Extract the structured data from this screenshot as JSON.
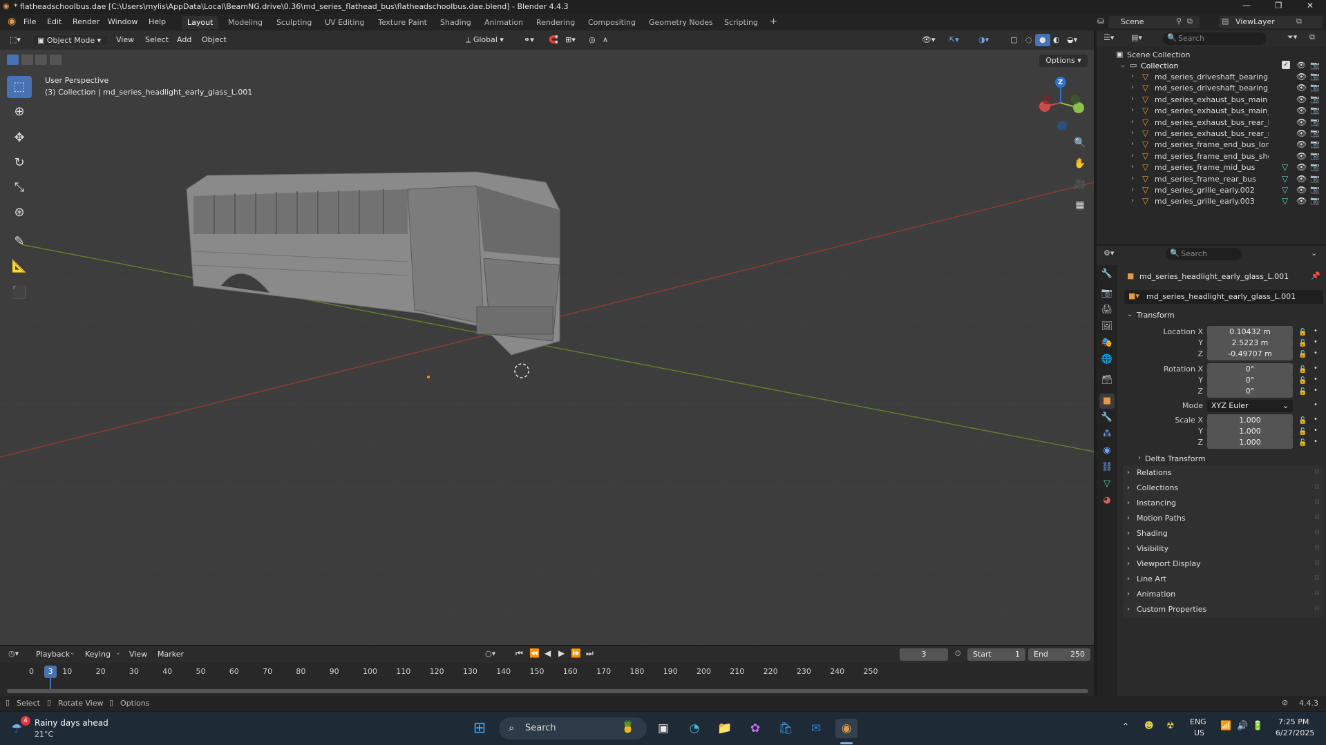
{
  "window": {
    "title": "* flatheadschoolbus.dae [C:\\Users\\mylis\\AppData\\Local\\BeamNG.drive\\0.36\\md_series_flathead_bus\\flatheadschoolbus.dae.blend] - Blender 4.4.3"
  },
  "menu": {
    "items": [
      "File",
      "Edit",
      "Render",
      "Window",
      "Help"
    ],
    "workspaces": [
      "Layout",
      "Modeling",
      "Sculpting",
      "UV Editing",
      "Texture Paint",
      "Shading",
      "Animation",
      "Rendering",
      "Compositing",
      "Geometry Nodes",
      "Scripting"
    ],
    "active_workspace": "Layout",
    "add_tab": "+",
    "scene": "Scene",
    "view_layer": "ViewLayer"
  },
  "viewport": {
    "mode": "Object Mode",
    "menus": [
      "View",
      "Select",
      "Add",
      "Object"
    ],
    "orientation": "Global",
    "options_label": "Options",
    "perspective": "User Perspective",
    "active_info": "(3) Collection | md_series_headlight_early_glass_L.001",
    "gizmo_z": "Z"
  },
  "outliner": {
    "search_placeholder": "Search",
    "scene_collection": "Scene Collection",
    "collection": "Collection",
    "objects": [
      {
        "name": "md_series_driveshaft_bearing",
        "mesh": false
      },
      {
        "name": "md_series_driveshaft_bearing_spa",
        "mesh": false
      },
      {
        "name": "md_series_exhaust_bus_main",
        "mesh": false
      },
      {
        "name": "md_series_exhaust_bus_main_alt",
        "mesh": false
      },
      {
        "name": "md_series_exhaust_bus_rear_long",
        "mesh": false
      },
      {
        "name": "md_series_exhaust_bus_rear_shor",
        "mesh": false
      },
      {
        "name": "md_series_frame_end_bus_long",
        "mesh": false
      },
      {
        "name": "md_series_frame_end_bus_short",
        "mesh": false
      },
      {
        "name": "md_series_frame_mid_bus",
        "mesh": true
      },
      {
        "name": "md_series_frame_rear_bus",
        "mesh": true
      },
      {
        "name": "md_series_grille_early.002",
        "mesh": true
      },
      {
        "name": "md_series_grille_early.003",
        "mesh": true
      }
    ]
  },
  "properties": {
    "search_placeholder": "Search",
    "object_name": "md_series_headlight_early_glass_L.001",
    "object_field": "md_series_headlight_early_glass_L.001",
    "transform_title": "Transform",
    "location_label": "Location X",
    "location": {
      "x": "0.10432 m",
      "y": "2.5223 m",
      "z": "-0.49707 m"
    },
    "rotation_label": "Rotation X",
    "rotation": {
      "x": "0°",
      "y": "0°",
      "z": "0°"
    },
    "mode_label": "Mode",
    "mode_value": "XYZ Euler",
    "scale_label": "Scale X",
    "scale": {
      "x": "1.000",
      "y": "1.000",
      "z": "1.000"
    },
    "axis_y": "Y",
    "axis_z": "Z",
    "delta_transform": "Delta Transform",
    "sections": [
      "Relations",
      "Collections",
      "Instancing",
      "Motion Paths",
      "Shading",
      "Visibility",
      "Viewport Display",
      "Line Art",
      "Animation",
      "Custom Properties"
    ]
  },
  "timeline": {
    "menus": [
      "Playback",
      "Keying",
      "View",
      "Marker"
    ],
    "current_frame": "3",
    "start_label": "Start",
    "start": "1",
    "end_label": "End",
    "end": "250",
    "ticks": [
      "0",
      "10",
      "20",
      "30",
      "40",
      "50",
      "60",
      "70",
      "80",
      "90",
      "100",
      "110",
      "120",
      "130",
      "140",
      "150",
      "160",
      "170",
      "180",
      "190",
      "200",
      "210",
      "220",
      "230",
      "240",
      "250"
    ]
  },
  "statusbar": {
    "select": "Select",
    "rotate": "Rotate View",
    "options": "Options",
    "version": "4.4.3"
  },
  "taskbar": {
    "weather_badge": "4",
    "weather_title": "Rainy days ahead",
    "weather_temp": "21°C",
    "search_placeholder": "Search",
    "lang": "ENG",
    "region": "US",
    "time": "7:25 PM",
    "date": "6/27/2025"
  },
  "colors": {
    "accent": "#4772b3",
    "object_orange": "#e59a43",
    "x_axis": "#c8463c",
    "y_axis": "#76a52e"
  }
}
